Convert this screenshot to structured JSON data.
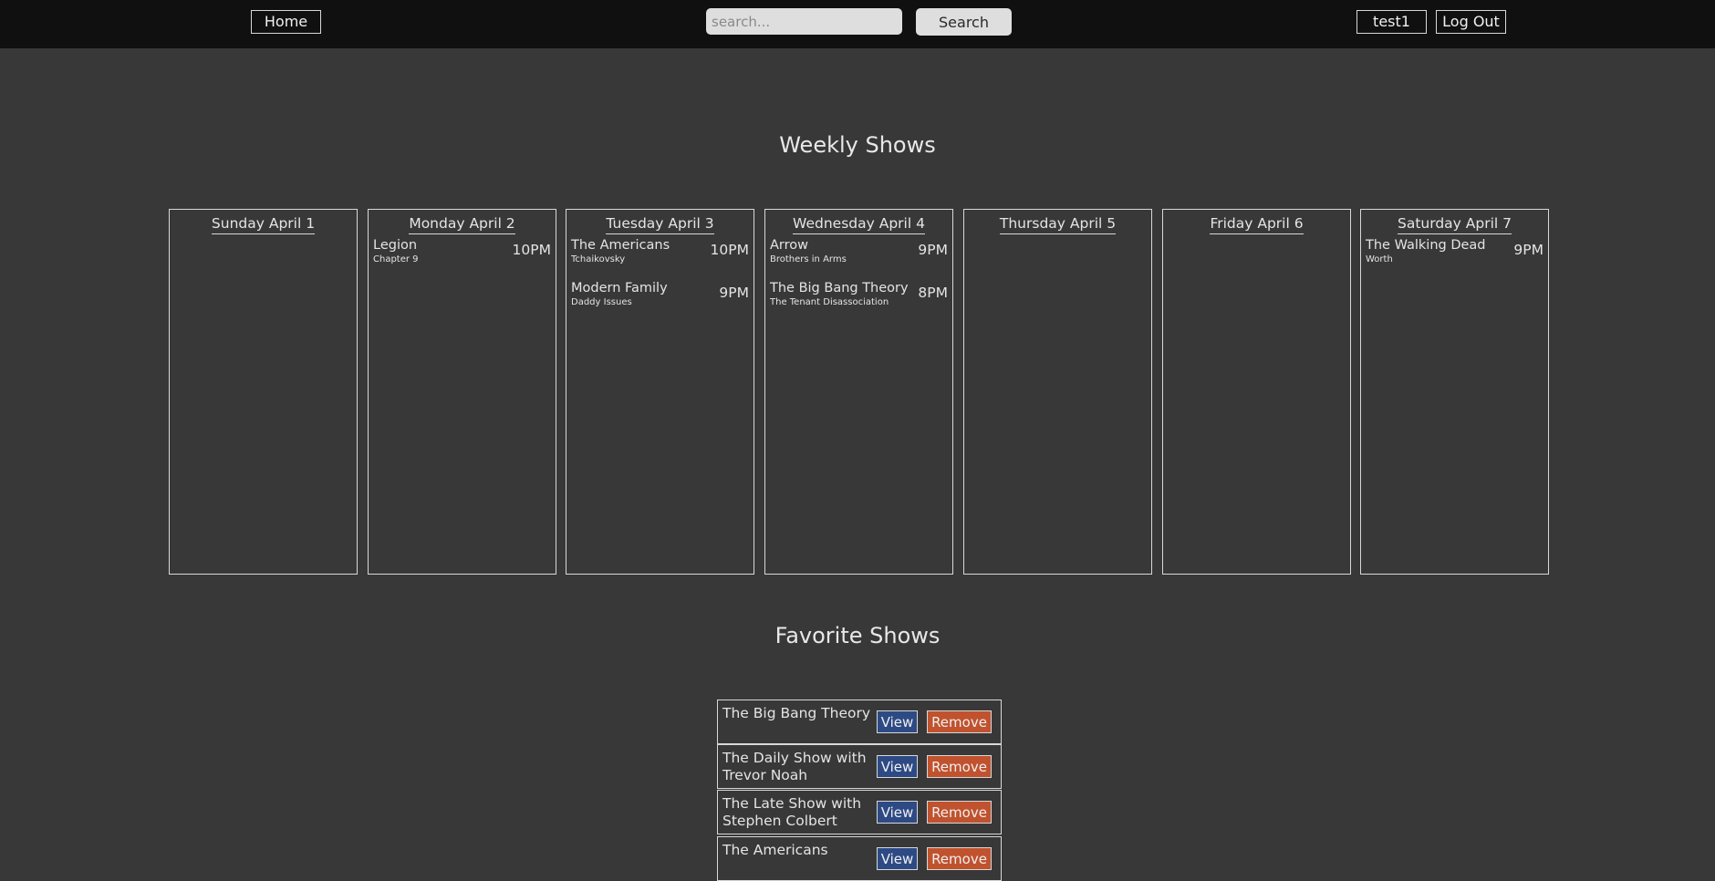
{
  "nav": {
    "home_label": "Home",
    "search_placeholder": "search...",
    "search_label": "Search",
    "user_label": "test1",
    "logout_label": "Log Out"
  },
  "weekly": {
    "title": "Weekly Shows",
    "days": [
      {
        "label": "Sunday April 1",
        "episodes": []
      },
      {
        "label": "Monday April 2",
        "episodes": [
          {
            "show": "Legion",
            "episode": "Chapter 9",
            "time": "10PM"
          }
        ]
      },
      {
        "label": "Tuesday April 3",
        "episodes": [
          {
            "show": "The Americans",
            "episode": "Tchaikovsky",
            "time": "10PM"
          },
          {
            "show": "Modern Family",
            "episode": "Daddy Issues",
            "time": "9PM"
          }
        ]
      },
      {
        "label": "Wednesday April 4",
        "episodes": [
          {
            "show": "Arrow",
            "episode": "Brothers in Arms",
            "time": "9PM"
          },
          {
            "show": "The Big Bang Theory",
            "episode": "The Tenant Disassociation",
            "time": "8PM"
          }
        ]
      },
      {
        "label": "Thursday April 5",
        "episodes": []
      },
      {
        "label": "Friday April 6",
        "episodes": []
      },
      {
        "label": "Saturday April 7",
        "episodes": [
          {
            "show": "The Walking Dead",
            "episode": "Worth",
            "time": "9PM"
          }
        ]
      }
    ]
  },
  "favorites": {
    "title": "Favorite Shows",
    "view_label": "View",
    "remove_label": "Remove",
    "items": [
      {
        "name": "The Big Bang Theory"
      },
      {
        "name": "The Daily Show with Trevor Noah"
      },
      {
        "name": "The Late Show with Stephen Colbert"
      },
      {
        "name": "The Americans"
      }
    ]
  },
  "colors": {
    "page_bg": "#383838",
    "navbar_bg": "#101010",
    "view_button": "#2d4a85",
    "remove_button": "#c0522e"
  }
}
